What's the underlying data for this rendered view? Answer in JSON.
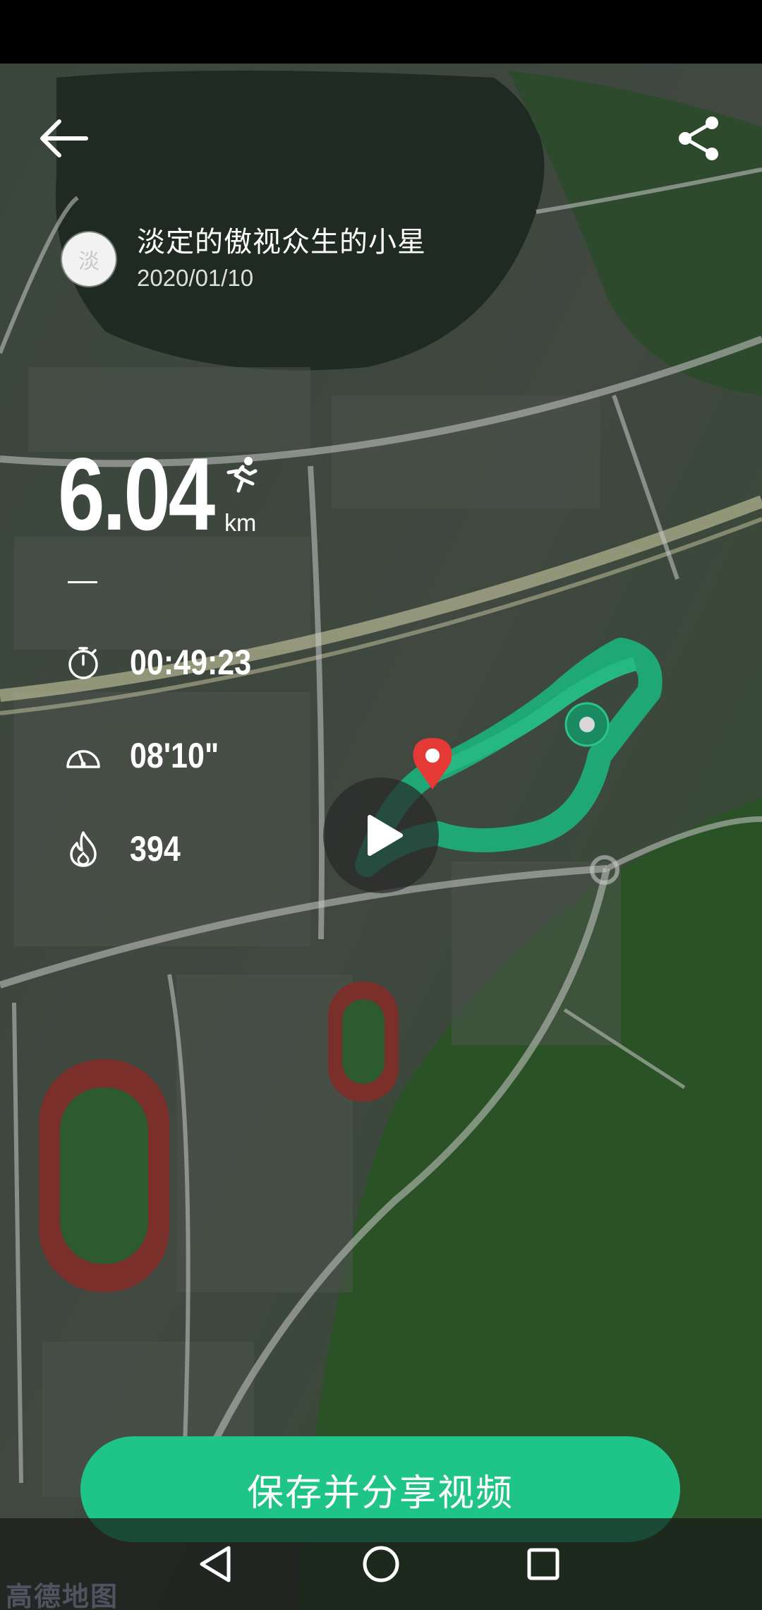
{
  "header": {
    "back_icon": "arrow-left-icon",
    "share_icon": "share-icon"
  },
  "user": {
    "avatar_text": "淡",
    "name": "淡定的傲视众生的小星",
    "date": "2020/01/10"
  },
  "distance": {
    "value": "6.04",
    "unit": "km",
    "icon": "runner-icon"
  },
  "stats": {
    "duration": {
      "icon": "stopwatch-icon",
      "value": "00:49:23"
    },
    "pace": {
      "icon": "speedometer-icon",
      "value": "08'10\""
    },
    "calories": {
      "icon": "flame-icon",
      "value": "394"
    }
  },
  "map": {
    "route_color": "#1fa876",
    "start_marker_color": "#e53935",
    "play_icon": "play-icon",
    "watermark": "高德地图"
  },
  "actions": {
    "save_share_label": "保存并分享视频"
  },
  "colors": {
    "accent": "#1fc488",
    "text": "#ffffff"
  },
  "nav": {
    "back_icon": "nav-back-icon",
    "home_icon": "nav-home-icon",
    "recents_icon": "nav-recents-icon"
  }
}
